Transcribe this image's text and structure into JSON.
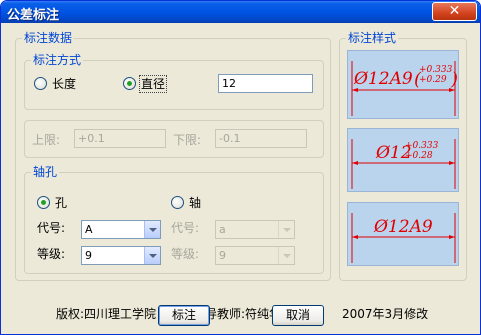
{
  "window": {
    "title": "公差标注",
    "close_symbol": "✕"
  },
  "data_group": {
    "title": "标注数据",
    "mode_group": {
      "title": "标注方式",
      "options": [
        {
          "label": "长度",
          "checked": false
        },
        {
          "label": "直径",
          "checked": true
        }
      ],
      "value": "12"
    },
    "limits": {
      "upper_label": "上限:",
      "upper_value": "+0.1",
      "lower_label": "下限:",
      "lower_value": "-0.1"
    },
    "fit_group": {
      "title": "轴孔",
      "hole": {
        "label": "孔",
        "checked": true,
        "code_label": "代号:",
        "code_value": "A",
        "grade_label": "等级:",
        "grade_value": "9"
      },
      "shaft": {
        "label": "轴",
        "checked": false,
        "code_label": "代号:",
        "code_value": "a",
        "grade_label": "等级:",
        "grade_value": "9"
      }
    }
  },
  "style_group": {
    "title": "标注样式",
    "samples": [
      {
        "main": "Ø12A9",
        "upper": "+0.333",
        "lower": "+0.29",
        "bracket": true
      },
      {
        "main": "Ø12",
        "upper": "+0.333",
        "lower": "+0.28",
        "bracket": false
      },
      {
        "main": "Ø12A9"
      }
    ],
    "colors": {
      "sample_bg": "#bbd4ee",
      "annotation": "#e00000"
    }
  },
  "footer": {
    "copyright": "版权:四川理工学院",
    "advisor": "指导教师:符纯华老师",
    "revision": "2007年3月修改"
  },
  "buttons": {
    "annotate": "标注",
    "cancel": "取消"
  }
}
